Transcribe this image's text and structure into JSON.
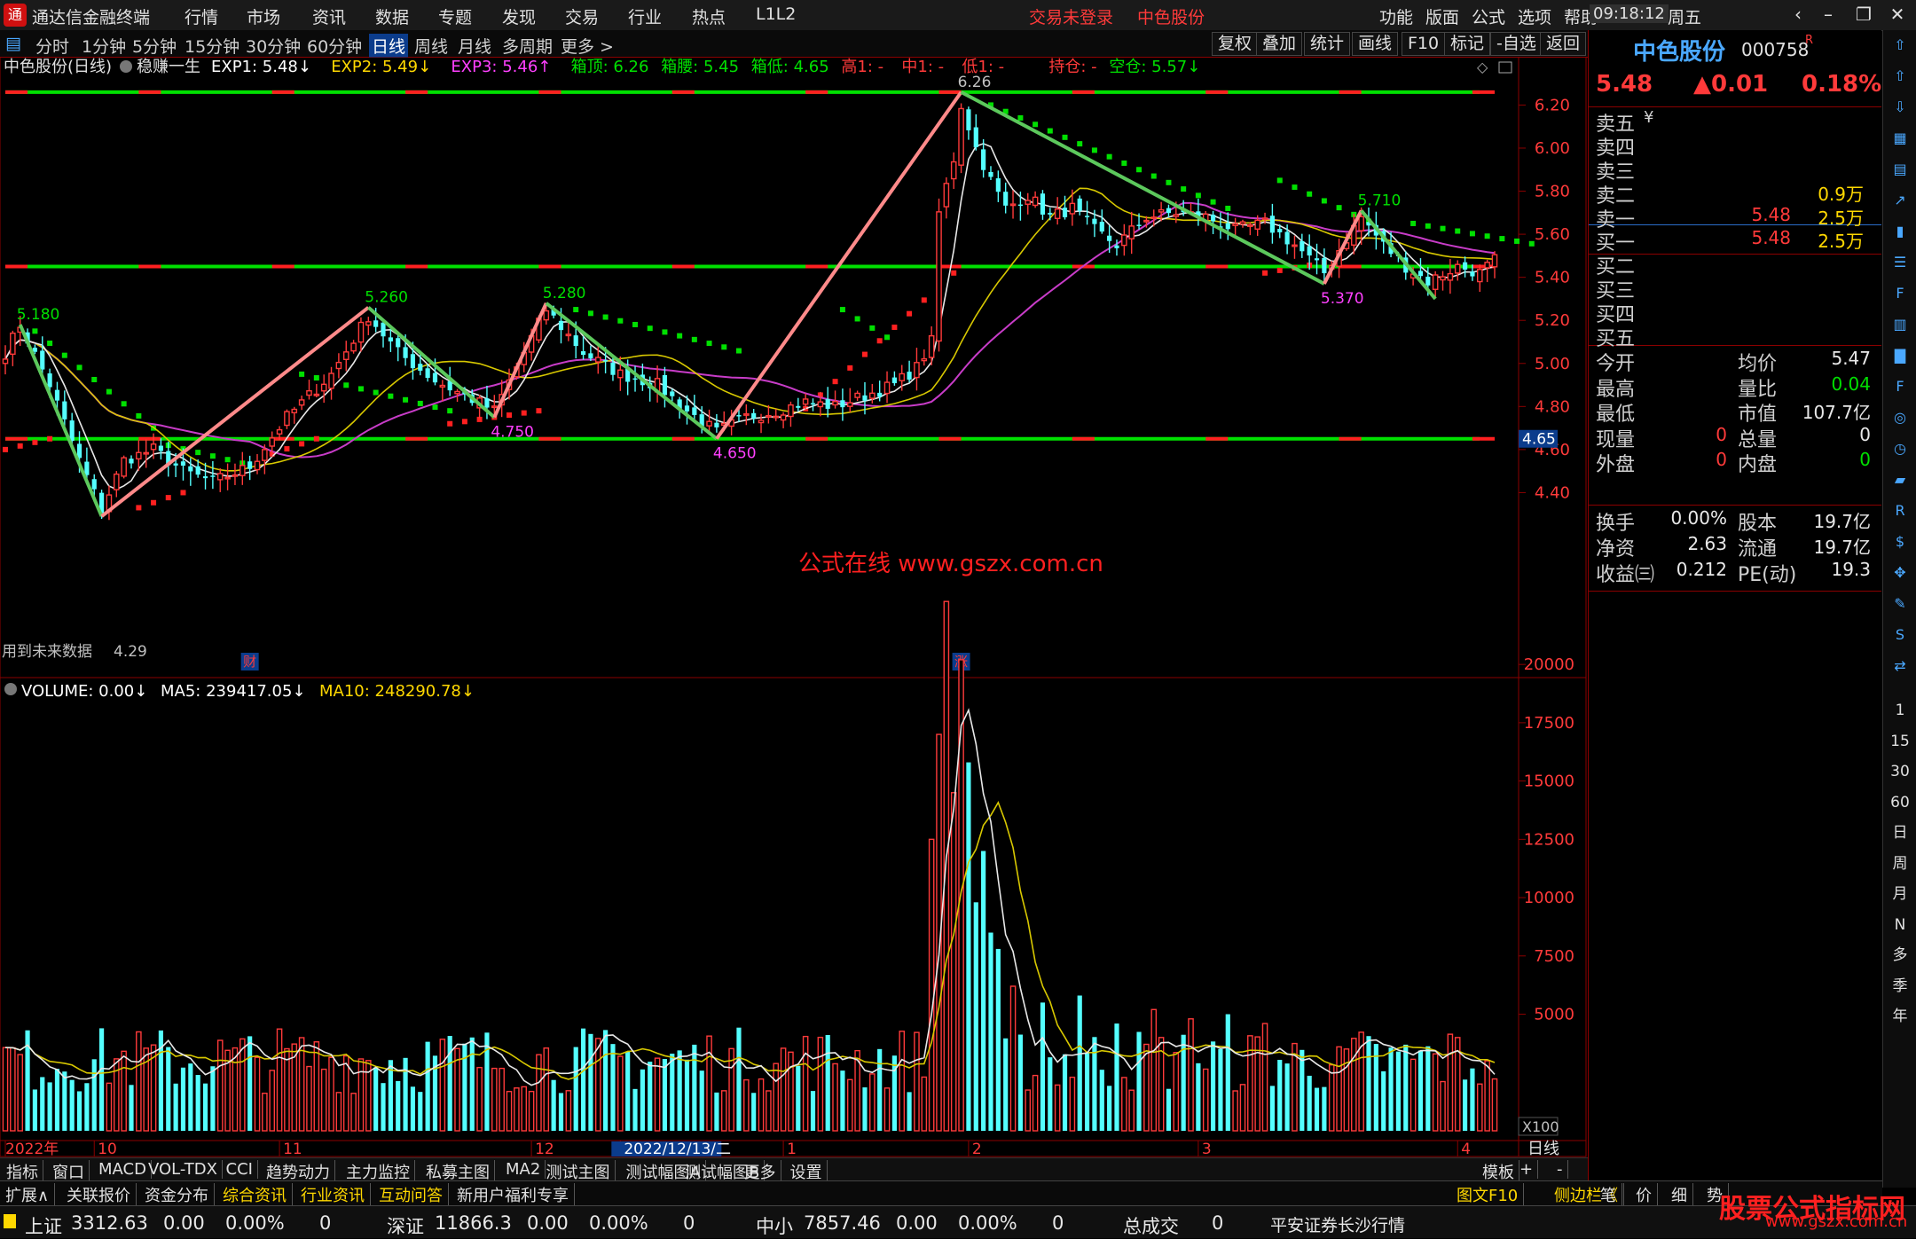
{
  "app": {
    "title": "通达信金融终端",
    "menus": [
      "行情",
      "市场",
      "资讯",
      "数据",
      "专题",
      "发现",
      "交易",
      "行业",
      "热点",
      "L1L2"
    ],
    "login_status": "交易未登录",
    "stock_name_header": "中色股份",
    "right_menus": [
      "功能",
      "版面",
      "公式",
      "选项",
      "帮助"
    ],
    "time": "09:18:12",
    "weekday": "周五"
  },
  "period_bar": {
    "periods": [
      "分时",
      "1分钟",
      "5分钟",
      "15分钟",
      "30分钟",
      "60分钟",
      "日线",
      "周线",
      "月线",
      "多周期",
      "更多 >"
    ],
    "active_index": 6,
    "tools": [
      "复权",
      "叠加",
      "统计",
      "画线",
      "F10",
      "标记",
      "-自选",
      "返回"
    ]
  },
  "indicator_header": {
    "title": "中色股份(日线)",
    "formula": "稳赚一生",
    "items": [
      {
        "text": "EXP1: 5.48↓",
        "color": "#ffffff"
      },
      {
        "text": "EXP2: 5.49↓",
        "color": "#ffd800"
      },
      {
        "text": "EXP3: 5.46↑",
        "color": "#ff40ff"
      },
      {
        "text": "箱顶: 6.26",
        "color": "#00e000"
      },
      {
        "text": "箱腰: 5.45",
        "color": "#00e000"
      },
      {
        "text": "箱低: 4.65",
        "color": "#00e000"
      },
      {
        "text": "高1: -",
        "color": "#ff3a3a"
      },
      {
        "text": "中1: -",
        "color": "#ff3a3a"
      },
      {
        "text": "低1: -",
        "color": "#ff3a3a"
      },
      {
        "text": "持仓: -",
        "color": "#ff3a3a"
      },
      {
        "text": "空仓: 5.57↓",
        "color": "#00e000"
      }
    ]
  },
  "main_chart": {
    "price_ticks": [
      "6.20",
      "6.00",
      "5.80",
      "5.60",
      "5.40",
      "5.20",
      "5.00",
      "4.80",
      "4.60",
      "4.40"
    ],
    "price_tick_values": [
      6.2,
      6.0,
      5.8,
      5.6,
      5.4,
      5.2,
      5.0,
      4.8,
      4.6,
      4.4
    ],
    "current_price_label": "4.65",
    "box_top": 6.26,
    "box_mid": 5.45,
    "box_bottom": 4.65,
    "peak_labels": [
      {
        "text": "5.180",
        "v": 5.18,
        "i": 2,
        "color": "#00e000"
      },
      {
        "text": "5.260",
        "v": 5.26,
        "i": 49,
        "color": "#00e000"
      },
      {
        "text": "5.280",
        "v": 5.28,
        "i": 73,
        "color": "#00e000"
      },
      {
        "text": "6.26",
        "v": 6.26,
        "i": 129,
        "color": "#c0c0c0"
      },
      {
        "text": "5.710",
        "v": 5.71,
        "i": 183,
        "color": "#00e000"
      },
      {
        "text": "4.750",
        "v": 4.75,
        "i": 66,
        "color": "#ff40ff"
      },
      {
        "text": "4.650",
        "v": 4.65,
        "i": 96,
        "color": "#ff40ff"
      },
      {
        "text": "5.370",
        "v": 5.37,
        "i": 178,
        "color": "#ff40ff"
      }
    ],
    "watermark_text": "公式在线 www.gszx.com.cn",
    "future_note": "用到未来数据",
    "low_note": "4.29",
    "markers": [
      {
        "text": "财",
        "i": 33
      },
      {
        "text": "涨",
        "i": 129
      }
    ],
    "zigzag": [
      {
        "i": 2,
        "v": 5.18
      },
      {
        "i": 13,
        "v": 4.29
      },
      {
        "i": 49,
        "v": 5.26
      },
      {
        "i": 66,
        "v": 4.75
      },
      {
        "i": 73,
        "v": 5.28
      },
      {
        "i": 96,
        "v": 4.65
      },
      {
        "i": 129,
        "v": 6.26
      },
      {
        "i": 178,
        "v": 5.37
      },
      {
        "i": 183,
        "v": 5.71
      },
      {
        "i": 193,
        "v": 5.3
      }
    ]
  },
  "volume_chart": {
    "header": [
      {
        "text": "VOLUME: 0.00↓",
        "color": "#ffffff"
      },
      {
        "text": "MA5: 239417.05↓",
        "color": "#ffffff"
      },
      {
        "text": "MA10: 248290.78↓",
        "color": "#ffd800"
      }
    ],
    "ticks": [
      "20000",
      "17500",
      "15000",
      "12500",
      "10000",
      "7500",
      "5000"
    ],
    "tick_values": [
      20000,
      17500,
      15000,
      12500,
      10000,
      7500,
      5000
    ],
    "unit": "X100"
  },
  "date_axis": {
    "labels": [
      {
        "text": "2022年",
        "i": 0
      },
      {
        "text": "10",
        "i": 12
      },
      {
        "text": "11",
        "i": 37
      },
      {
        "text": "12",
        "i": 71
      },
      {
        "text": "2022/12/13/二",
        "i": 83
      },
      {
        "text": "1",
        "i": 105
      },
      {
        "text": "2",
        "i": 130
      },
      {
        "text": "3",
        "i": 161
      },
      {
        "text": "4",
        "i": 196
      }
    ],
    "period_label": "日线"
  },
  "chart_data": {
    "type": "candlestick",
    "title": "中色股份(日线)",
    "count": 202,
    "ylim": [
      4.2,
      6.35
    ],
    "seed_closes": [
      [
        0,
        5.05
      ],
      [
        2,
        5.18
      ],
      [
        6,
        4.9
      ],
      [
        10,
        4.55
      ],
      [
        13,
        4.32
      ],
      [
        16,
        4.55
      ],
      [
        20,
        4.6
      ],
      [
        24,
        4.5
      ],
      [
        28,
        4.45
      ],
      [
        33,
        4.52
      ],
      [
        38,
        4.75
      ],
      [
        44,
        4.95
      ],
      [
        49,
        5.22
      ],
      [
        53,
        5.05
      ],
      [
        58,
        4.92
      ],
      [
        62,
        4.85
      ],
      [
        66,
        4.78
      ],
      [
        70,
        5.05
      ],
      [
        73,
        5.25
      ],
      [
        78,
        5.05
      ],
      [
        83,
        4.95
      ],
      [
        88,
        4.9
      ],
      [
        92,
        4.78
      ],
      [
        96,
        4.68
      ],
      [
        100,
        4.75
      ],
      [
        104,
        4.78
      ],
      [
        108,
        4.82
      ],
      [
        112,
        4.8
      ],
      [
        116,
        4.85
      ],
      [
        120,
        4.9
      ],
      [
        123,
        4.98
      ],
      [
        125,
        5.1
      ],
      [
        126,
        5.7
      ],
      [
        128,
        5.95
      ],
      [
        129,
        6.2
      ],
      [
        131,
        6.0
      ],
      [
        133,
        5.85
      ],
      [
        135,
        5.72
      ],
      [
        138,
        5.78
      ],
      [
        141,
        5.68
      ],
      [
        144,
        5.72
      ],
      [
        147,
        5.62
      ],
      [
        150,
        5.55
      ],
      [
        154,
        5.68
      ],
      [
        158,
        5.7
      ],
      [
        162,
        5.68
      ],
      [
        166,
        5.62
      ],
      [
        170,
        5.65
      ],
      [
        174,
        5.55
      ],
      [
        178,
        5.42
      ],
      [
        181,
        5.58
      ],
      [
        183,
        5.68
      ],
      [
        186,
        5.55
      ],
      [
        189,
        5.45
      ],
      [
        192,
        5.38
      ],
      [
        196,
        5.45
      ],
      [
        199,
        5.42
      ],
      [
        201,
        5.48
      ]
    ],
    "volume_spikes": [
      [
        125,
        12500
      ],
      [
        126,
        17000
      ],
      [
        127,
        22700
      ],
      [
        128,
        14500
      ],
      [
        129,
        20200
      ],
      [
        130,
        15800
      ],
      [
        131,
        9800
      ],
      [
        132,
        12000
      ],
      [
        133,
        8500
      ],
      [
        134,
        7800
      ],
      [
        136,
        6200
      ],
      [
        140,
        5500
      ],
      [
        145,
        5800
      ],
      [
        150,
        4600
      ],
      [
        155,
        5200
      ],
      [
        160,
        4800
      ],
      [
        165,
        5000
      ],
      [
        170,
        4600
      ],
      [
        180,
        3600
      ],
      [
        188,
        3400
      ],
      [
        196,
        4000
      ],
      [
        200,
        3000
      ]
    ],
    "volume_base": 3200
  },
  "right_panel": {
    "stock_name": "中色股份",
    "stock_code": "000758",
    "price": "5.48",
    "change": "▲0.01",
    "change_pct": "0.18%",
    "asks": [
      {
        "label": "卖五",
        "price": "",
        "vol": ""
      },
      {
        "label": "卖四",
        "price": "",
        "vol": ""
      },
      {
        "label": "卖三",
        "price": "",
        "vol": ""
      },
      {
        "label": "卖二",
        "price": "",
        "vol": "0.9万"
      },
      {
        "label": "卖一",
        "price": "5.48",
        "vol": "2.5万"
      }
    ],
    "bids": [
      {
        "label": "买一",
        "price": "5.48",
        "vol": "2.5万"
      },
      {
        "label": "买二",
        "price": "",
        "vol": ""
      },
      {
        "label": "买三",
        "price": "",
        "vol": ""
      },
      {
        "label": "买四",
        "price": "",
        "vol": ""
      },
      {
        "label": "买五",
        "price": "",
        "vol": ""
      }
    ],
    "ask_unit": "¥",
    "stats1": [
      {
        "l1": "今开",
        "v1": "",
        "l2": "均价",
        "v2": "5.47",
        "c2": "rp-white"
      },
      {
        "l1": "最高",
        "v1": "",
        "l2": "量比",
        "v2": "0.04",
        "c2": "rp-green"
      },
      {
        "l1": "最低",
        "v1": "",
        "l2": "市值",
        "v2": "107.7亿",
        "c2": "rp-white"
      },
      {
        "l1": "现量",
        "v1": "0",
        "c1": "rp-red",
        "l2": "总量",
        "v2": "0",
        "c2": "rp-white"
      },
      {
        "l1": "外盘",
        "v1": "0",
        "c1": "rp-red",
        "l2": "内盘",
        "v2": "0",
        "c2": "rp-green"
      }
    ],
    "stats2": [
      {
        "l1": "换手",
        "v1": "0.00%",
        "l2": "股本",
        "v2": "19.7亿"
      },
      {
        "l1": "净资",
        "v1": "2.63",
        "l2": "流通",
        "v2": "19.7亿"
      },
      {
        "l1": "收益㈢",
        "v1": "0.212",
        "l2": "PE(动)",
        "v2": "19.3"
      }
    ]
  },
  "icon_column": {
    "icons": [
      "up-arrow-icon",
      "up-arrow-icon",
      "down-arrow-icon",
      "grid-icon",
      "table-icon",
      "trend-icon",
      "kline-icon",
      "list-icon",
      "f10-icon",
      "chart-icon",
      "bar-icon",
      "f2-icon",
      "compass-icon",
      "clock-icon",
      "macd-icon",
      "rsi-icon",
      "money-icon",
      "move-icon",
      "pen-icon",
      "fs-icon",
      "swap-icon"
    ],
    "period_texts": [
      "1",
      "15",
      "30",
      "60",
      "日",
      "周",
      "月",
      "N",
      "多",
      "季",
      "年"
    ]
  },
  "tabbar1": {
    "tabs": [
      "指标",
      "窗口",
      "MACD",
      "VOL-TDX",
      "CCI",
      "趋势动力",
      "主力监控",
      "私募主图",
      "MA2",
      "测试主图",
      "测试幅图A",
      "测试幅图B",
      "更多",
      "设置"
    ],
    "right": [
      "模板",
      "+",
      "-"
    ]
  },
  "tabbar2": {
    "tabs": [
      {
        "text": "扩展∧",
        "yellow": false
      },
      {
        "text": "关联报价",
        "yellow": false
      },
      {
        "text": "资金分布",
        "yellow": false
      },
      {
        "text": "综合资讯",
        "yellow": true
      },
      {
        "text": "行业资讯",
        "yellow": true
      },
      {
        "text": "互动问答",
        "yellow": true
      },
      {
        "text": "新用户福利专享",
        "yellow": false
      }
    ],
    "right": [
      "图文F10",
      "侧边栏《",
      "笔",
      "价",
      "细",
      "势"
    ]
  },
  "statusbar": {
    "indices": [
      {
        "name": "上证",
        "value": "3312.63",
        "chg": "0.00",
        "pct": "0.00%",
        "vol": "0"
      },
      {
        "name": "深证",
        "value": "11866.3",
        "chg": "0.00",
        "pct": "0.00%",
        "vol": "0"
      },
      {
        "name": "中小",
        "value": "7857.46",
        "chg": "0.00",
        "pct": "0.00%",
        "vol": "0"
      }
    ],
    "turnover_label": "总成交",
    "turnover_value": "0",
    "broker": "平安证券长沙行情"
  },
  "site_watermark": {
    "title": "股票公式指标网",
    "url": "www.gszx.com.cn"
  },
  "colors": {
    "up": "#ff3a3a",
    "down": "#54ffff",
    "box_line": "#00e000",
    "accent_blue": "#4aa8ff",
    "zig_up": "#ff8a8a",
    "zig_down": "#5cc85c"
  }
}
